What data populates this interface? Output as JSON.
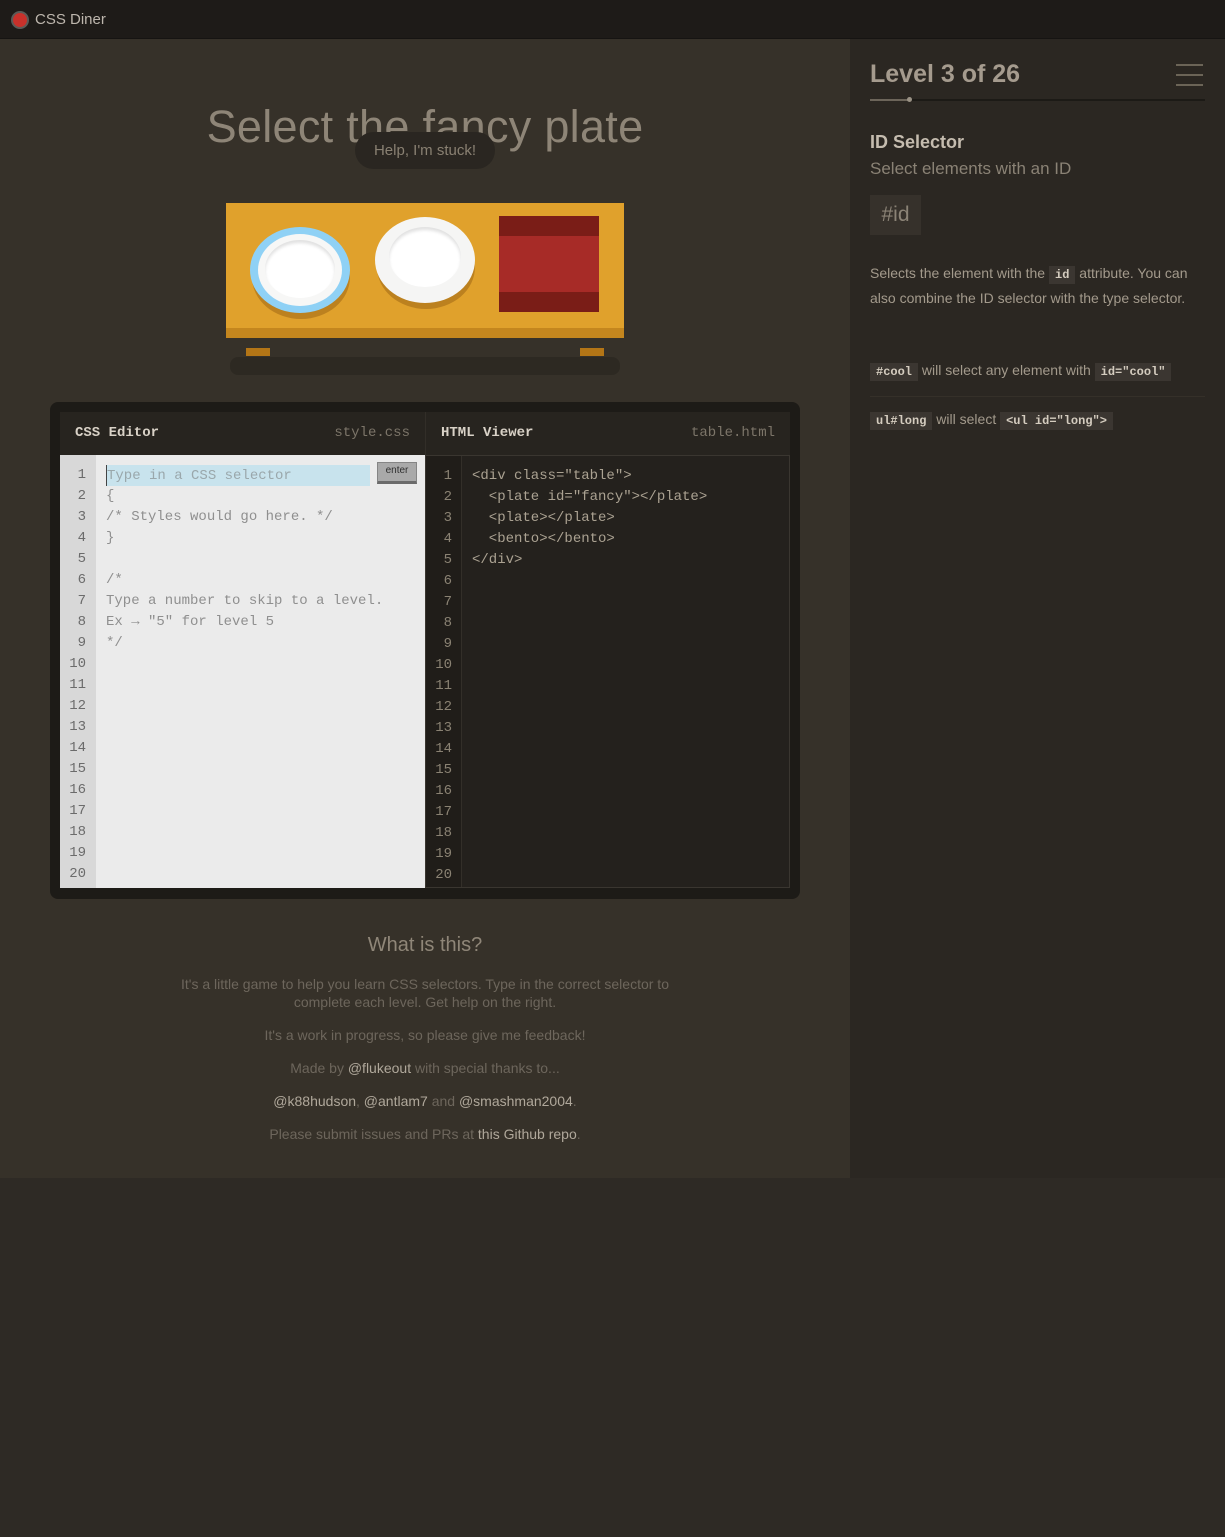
{
  "app": {
    "title": "CSS Diner"
  },
  "main": {
    "order": "Select the fancy plate",
    "help_label": "Help, I'm stuck!"
  },
  "editor": {
    "css_title": "CSS Editor",
    "css_filename": "style.css",
    "html_title": "HTML Viewer",
    "html_filename": "table.html",
    "input_placeholder": "Type in a CSS selector",
    "input_value": "",
    "enter_label": "enter",
    "line_numbers": [
      "1",
      "2",
      "3",
      "4",
      "5",
      "6",
      "7",
      "8",
      "9",
      "10",
      "11",
      "12",
      "13",
      "14",
      "15",
      "16",
      "17",
      "18",
      "19",
      "20"
    ],
    "css_lines": [
      "",
      "{",
      "/* Styles would go here. */",
      "}",
      "",
      "/*",
      "Type a number to skip to a level.",
      "Ex → \"5\" for level 5",
      "*/"
    ],
    "html_lines": [
      "<div class=\"table\">",
      "  <plate id=\"fancy\"></plate>",
      "  <plate></plate>",
      "  <bento></bento>",
      "</div>"
    ]
  },
  "about": {
    "heading": "What is this?",
    "p1": "It's a little game to help you learn CSS selectors. Type in the correct selector to complete each level. Get help on the right.",
    "p2": "It's a work in progress, so please give me feedback!",
    "p3_pre": "Made by ",
    "p3_link": "@flukeout",
    "p3_post": " with special thanks to...",
    "p4_link1": "@k88hudson",
    "p4_sep1": ", ",
    "p4_link2": "@antlam7",
    "p4_sep2": " and ",
    "p4_link3": "@smashman2004",
    "p4_end": ".",
    "p5_pre": "Please submit issues and PRs at ",
    "p5_link": "this Github repo",
    "p5_end": "."
  },
  "sidebar": {
    "level_title": "Level 3 of 26",
    "level_current": 3,
    "level_total": 26,
    "selector_name": "ID Selector",
    "selector_title": "Select elements with an ID",
    "syntax": "#id",
    "hint_pre": "Selects the element with the ",
    "hint_code": "id",
    "hint_post": " attribute. You can also combine the ID selector with the type selector.",
    "examples": [
      {
        "code1": "#cool",
        "text": " will select any element with ",
        "code2": "id=\"cool\""
      },
      {
        "code1": "ul#long",
        "text": " will select ",
        "code2": "<ul id=\"long\">"
      }
    ]
  },
  "table_items": [
    "fancy plate",
    "plate",
    "bento"
  ],
  "colors": {
    "table": "#e0a12c",
    "fancy_rim": "#8fd1f5",
    "bento": "#a72b27",
    "logo": "#c8312b"
  }
}
